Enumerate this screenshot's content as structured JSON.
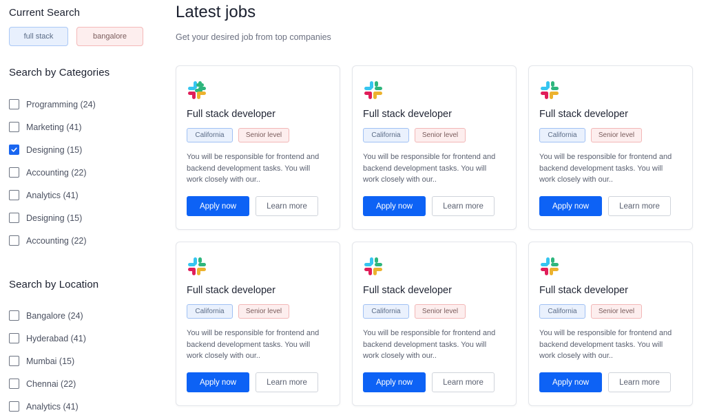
{
  "sidebar": {
    "current_search_title": "Current Search",
    "current_search_chips": [
      "full stack",
      "bangalore"
    ],
    "categories_title": "Search by Categories",
    "categories": [
      {
        "label": "Programming (24)",
        "checked": false
      },
      {
        "label": "Marketing (41)",
        "checked": false
      },
      {
        "label": "Designing (15)",
        "checked": true
      },
      {
        "label": "Accounting (22)",
        "checked": false
      },
      {
        "label": "Analytics (41)",
        "checked": false
      },
      {
        "label": "Designing (15)",
        "checked": false
      },
      {
        "label": "Accounting (22)",
        "checked": false
      }
    ],
    "location_title": "Search by Location",
    "locations": [
      {
        "label": "Bangalore (24)",
        "checked": false
      },
      {
        "label": "Hyderabad (41)",
        "checked": false
      },
      {
        "label": "Mumbai (15)",
        "checked": false
      },
      {
        "label": "Chennai (22)",
        "checked": false
      },
      {
        "label": "Analytics (41)",
        "checked": false
      }
    ]
  },
  "main": {
    "title": "Latest jobs",
    "subtitle": "Get your desired job from top companies",
    "jobs": [
      {
        "logo": "slack-logo",
        "title": "Full stack developer",
        "location_tag": "California",
        "level_tag": "Senior level",
        "description": "You will be responsible for frontend and backend development tasks. You will work closely with our..",
        "apply_label": "Apply now",
        "learn_label": "Learn more"
      },
      {
        "logo": "slack-logo",
        "title": "Full stack developer",
        "location_tag": "California",
        "level_tag": "Senior level",
        "description": "You will be responsible for frontend and backend development tasks. You will work closely with our..",
        "apply_label": "Apply now",
        "learn_label": "Learn more"
      },
      {
        "logo": "slack-logo",
        "title": "Full stack developer",
        "location_tag": "California",
        "level_tag": "Senior level",
        "description": "You will be responsible for frontend and backend development tasks. You will work closely with our..",
        "apply_label": "Apply now",
        "learn_label": "Learn more"
      },
      {
        "logo": "slack-logo",
        "title": "Full stack developer",
        "location_tag": "California",
        "level_tag": "Senior level",
        "description": "You will be responsible for frontend and backend development tasks. You will work closely with our..",
        "apply_label": "Apply now",
        "learn_label": "Learn more"
      },
      {
        "logo": "slack-logo",
        "title": "Full stack developer",
        "location_tag": "California",
        "level_tag": "Senior level",
        "description": "You will be responsible for frontend and backend development tasks. You will work closely with our..",
        "apply_label": "Apply now",
        "learn_label": "Learn more"
      },
      {
        "logo": "slack-logo",
        "title": "Full stack developer",
        "location_tag": "California",
        "level_tag": "Senior level",
        "description": "You will be responsible for frontend and backend development tasks. You will work closely with our..",
        "apply_label": "Apply now",
        "learn_label": "Learn more"
      }
    ]
  },
  "colors": {
    "primary": "#0d62f5",
    "chip_blue_bg": "#e8f0fd",
    "chip_red_bg": "#fdeeee"
  }
}
